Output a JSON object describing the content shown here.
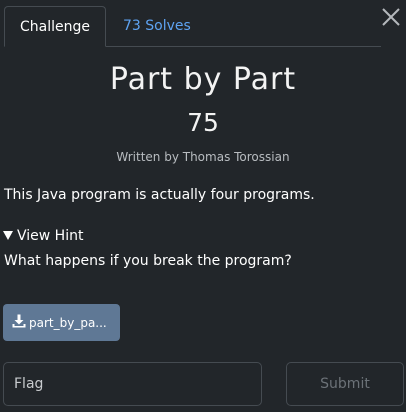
{
  "tabs": {
    "challenge": "Challenge",
    "solves": "73 Solves"
  },
  "challenge": {
    "title": "Part by Part",
    "points": "75",
    "author": "Written by Thomas Torossian",
    "description": "This Java program is actually four programs."
  },
  "hint": {
    "toggle_label": "View Hint",
    "text": "What happens if you break the program?"
  },
  "file": {
    "label": "part_by_pa..."
  },
  "flag": {
    "placeholder": "Flag",
    "value": ""
  },
  "submit": {
    "label": "Submit"
  },
  "icons": {
    "close": "close-icon",
    "download": "download-icon",
    "hint_arrow": "triangle-down-icon"
  },
  "colors": {
    "background": "#22262a",
    "tab_link": "#5ea3f2",
    "file_button": "#5f7895",
    "border": "#454b51"
  }
}
